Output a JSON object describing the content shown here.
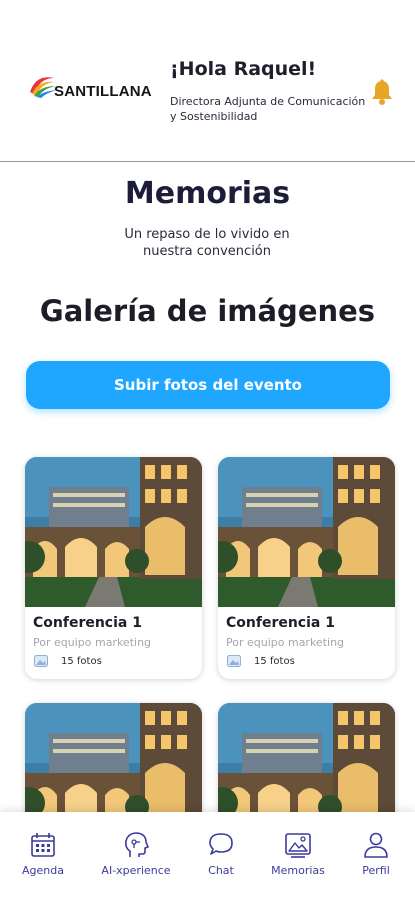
{
  "header": {
    "logo_text": "SANTILLANA",
    "greeting": "¡Hola Raquel!",
    "role": "Directora Adjunta de Comunicación y Sostenibilidad",
    "bell_icon": "bell-icon"
  },
  "page": {
    "title": "Memorias",
    "subtitle": "Un repaso de lo vivido en nuestra convención"
  },
  "gallery": {
    "title": "Galería de imágenes",
    "upload_label": "Subir fotos del evento",
    "cards": [
      {
        "title": "Conferencia 1",
        "author": "Por equipo marketing",
        "count": "15 fotos"
      },
      {
        "title": "Conferencia 1",
        "author": "Por equipo marketing",
        "count": "15 fotos"
      },
      {
        "title": "",
        "author": "",
        "count": ""
      },
      {
        "title": "",
        "author": "",
        "count": ""
      }
    ]
  },
  "nav": {
    "items": [
      {
        "label": "Agenda",
        "icon": "calendar-icon"
      },
      {
        "label": "AI-xperience",
        "icon": "ai-head-icon"
      },
      {
        "label": "Chat",
        "icon": "chat-icon"
      },
      {
        "label": "Memorias",
        "icon": "gallery-icon"
      },
      {
        "label": "Perfil",
        "icon": "user-icon"
      }
    ]
  },
  "colors": {
    "accent": "#1fa6ff",
    "nav_label": "#3b3b9a",
    "bell": "#e8a628"
  }
}
